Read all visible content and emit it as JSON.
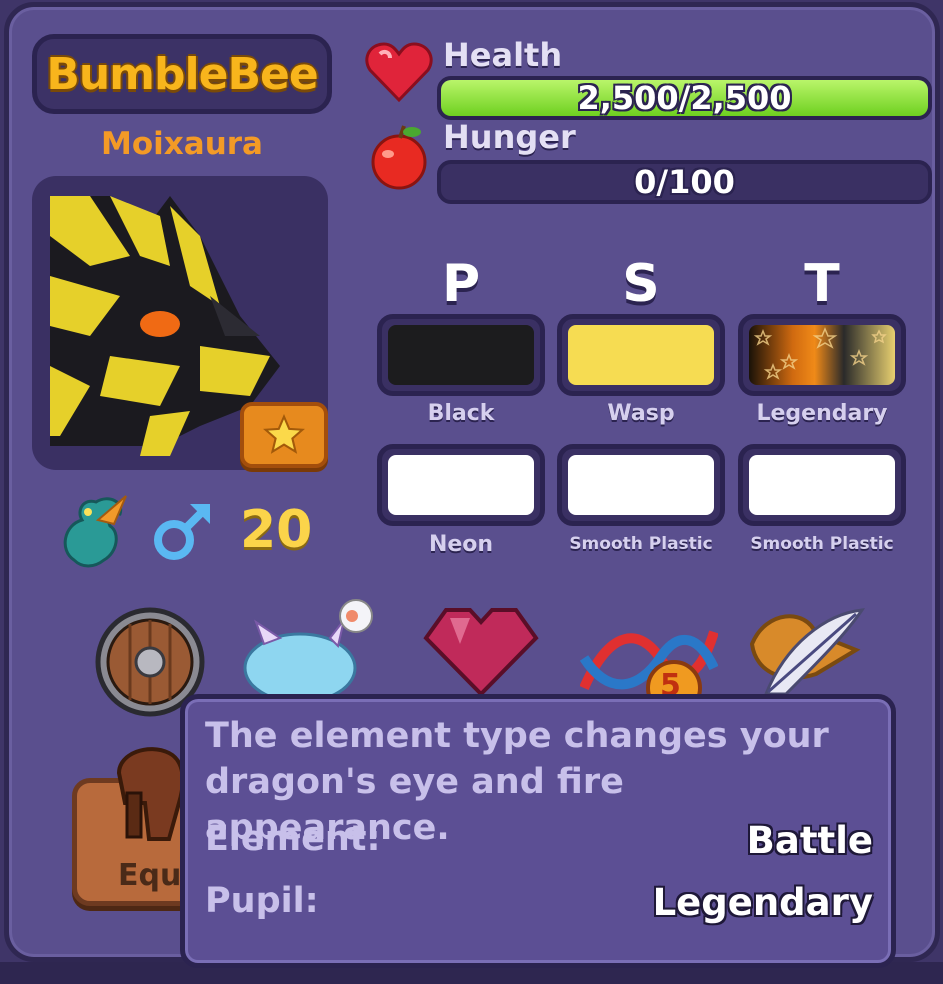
{
  "pet": {
    "name": "BumbleBee",
    "species": "Moixaura",
    "level": "20",
    "gender_icon": "male-symbol-icon"
  },
  "stats": {
    "health_label": "Health",
    "health_value": "2,500/2,500",
    "health_fraction": 1.0,
    "hunger_label": "Hunger",
    "hunger_value": "0/100",
    "hunger_fraction": 0.0
  },
  "colors": {
    "headers": [
      "P",
      "S",
      "T"
    ],
    "row1": [
      {
        "label": "Black",
        "color": "#1c1c1e"
      },
      {
        "label": "Wasp",
        "color": "#f6dc52"
      },
      {
        "label": "Legendary",
        "color": "gradient"
      }
    ],
    "row2": [
      {
        "label": "Neon",
        "color": "#ffffff"
      },
      {
        "label": "Smooth Plastic",
        "color": "#ffffff"
      },
      {
        "label": "Smooth Plastic",
        "color": "#ffffff"
      }
    ]
  },
  "icons": [
    "shield-icon",
    "pet-food-icon",
    "heart-gem-icon",
    "dna-icon",
    "feather-hat-icon"
  ],
  "dna_badge": "5",
  "tooltip": {
    "description": "The element type changes your dragon's eye and fire appearance.",
    "element_label": "Element:",
    "element_value": "Battle",
    "pupil_label": "Pupil:",
    "pupil_value": "Legendary"
  },
  "equip_button": {
    "label": "Equ"
  },
  "theme": {
    "panel": "#5a4f8e",
    "name_gold": "#f8b51c",
    "species_orange": "#f39a26",
    "health_green": "#7fd62a"
  }
}
